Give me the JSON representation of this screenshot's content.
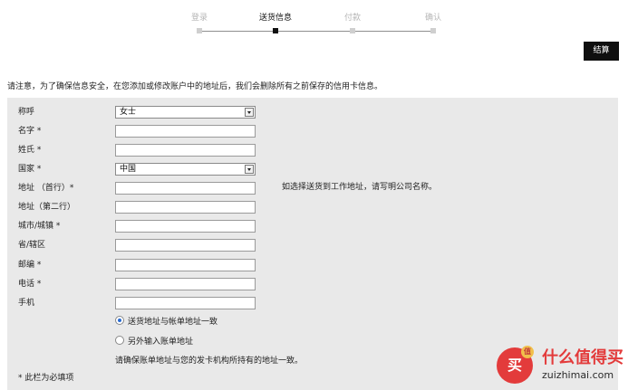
{
  "stepper": {
    "steps": [
      {
        "label": "登录",
        "active": false
      },
      {
        "label": "送货信息",
        "active": true
      },
      {
        "label": "付款",
        "active": false
      },
      {
        "label": "确认",
        "active": false
      }
    ]
  },
  "checkout": {
    "label": "结算"
  },
  "notice": "请注意，为了确保信息安全，在您添加或修改账户中的地址后，我们会删除所有之前保存的信用卡信息。",
  "form": {
    "salutation": {
      "label": "称呼",
      "value": "女士"
    },
    "first_name": {
      "label": "名字 *",
      "value": ""
    },
    "last_name": {
      "label": "姓氏 *",
      "value": ""
    },
    "country": {
      "label": "国家 *",
      "value": "中国"
    },
    "address1": {
      "label": "地址 （首行）*",
      "value": ""
    },
    "address1_hint": "如选择送货到工作地址，请写明公司名称。",
    "address2": {
      "label": "地址（第二行）",
      "value": ""
    },
    "city": {
      "label": "城市/城镇 *",
      "value": ""
    },
    "province": {
      "label": "省/辖区",
      "value": ""
    },
    "postal": {
      "label": "邮编 *",
      "value": ""
    },
    "phone": {
      "label": "电话 *",
      "value": ""
    },
    "mobile": {
      "label": "手机",
      "value": ""
    },
    "billing_same": {
      "label": "送货地址与帐单地址一致",
      "checked": true
    },
    "billing_other": {
      "label": "另外输入账单地址",
      "checked": false
    },
    "billing_note": "请确保账单地址与您的发卡机构所持有的地址一致。",
    "required_note": "* 此栏为必填项"
  },
  "watermark": {
    "glyph": "买",
    "badge": "值",
    "name": "什么值得买",
    "domain": "zuizhimai.com"
  }
}
